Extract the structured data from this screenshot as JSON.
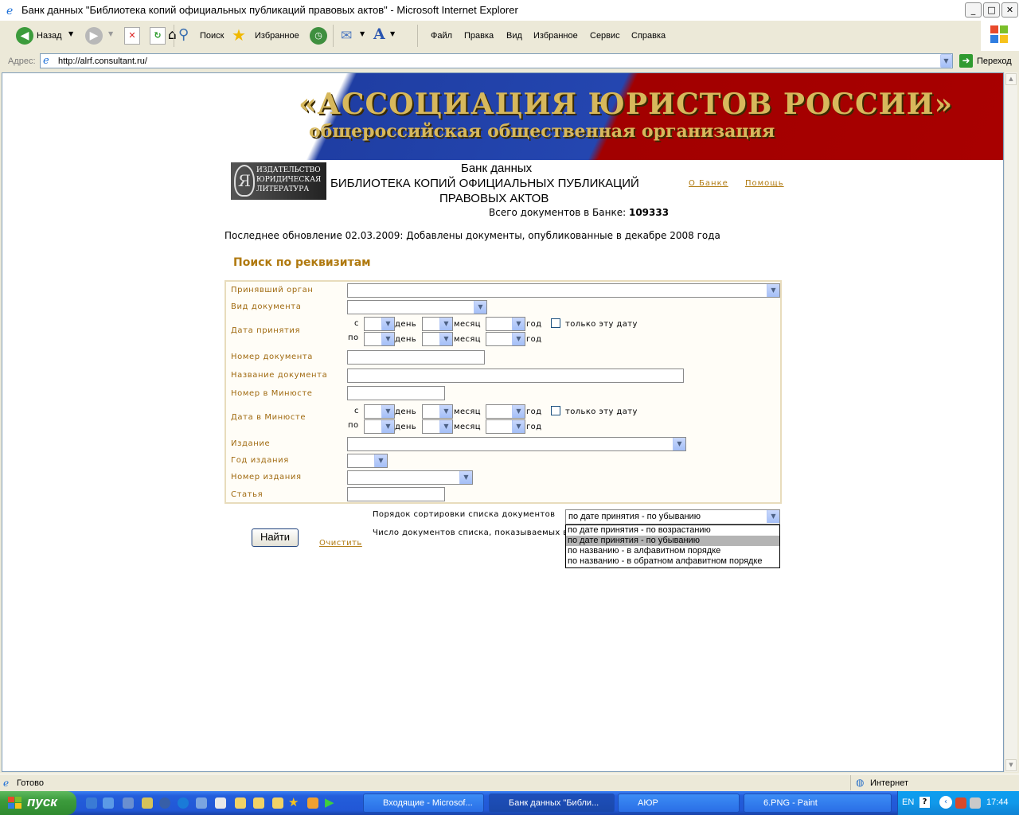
{
  "window": {
    "title": "Банк данных \"Библиотека копий официальных публикаций правовых актов\" - Microsoft Internet Explorer",
    "buttons": {
      "minimize": "_",
      "maximize": "□",
      "close": "✕"
    }
  },
  "toolbar": {
    "back_label": "Назад",
    "search_label": "Поиск",
    "favorites_label": "Избранное",
    "menu": [
      "Файл",
      "Правка",
      "Вид",
      "Избранное",
      "Сервис",
      "Справка"
    ]
  },
  "address": {
    "label": "Адрес:",
    "url": "http://alrf.consultant.ru/",
    "go_label": "Переход"
  },
  "banner": {
    "line1": "«АССОЦИАЦИЯ ЮРИСТОВ РОССИИ»",
    "line2": "общероссийская общественная организация"
  },
  "header": {
    "logo_text": [
      "ИЗДАТЕЛЬСТВО",
      "ЮРИДИЧЕСКАЯ",
      "ЛИТЕРАТУРА"
    ],
    "line1": "Банк данных",
    "line2": "БИБЛИОТЕКА КОПИЙ ОФИЦИАЛЬНЫХ ПУБЛИКАЦИЙ",
    "line3": "ПРАВОВЫХ АКТОВ",
    "count_label": "Всего документов в Банке:",
    "count_value": "109333",
    "about_link": "О Банке",
    "help_link": "Помощь"
  },
  "update_notice": "Последнее обновление 02.03.2009: Добавлены документы, опубликованные в декабре 2008 года",
  "search": {
    "title": "Поиск по реквизитам",
    "fields": {
      "organ": "Принявший орган",
      "doc_type": "Вид документа",
      "adopt_date": "Дата принятия",
      "doc_number": "Номер документа",
      "doc_name": "Название документа",
      "minjust_number": "Номер в Минюсте",
      "minjust_date": "Дата в Минюсте",
      "edition": "Издание",
      "edition_year": "Год издания",
      "edition_number": "Номер издания",
      "article": "Статья"
    },
    "date_words": {
      "from": "с",
      "to": "по",
      "day": "день",
      "month": "месяц",
      "year": "год",
      "only_this_date": "только эту дату"
    },
    "sort_label": "Порядок сортировки списка документов",
    "count_label": "Число документов списка, показываемых в",
    "sort_selected": "по дате принятия - по убыванию",
    "sort_options": [
      "по дате принятия - по возрастанию",
      "по дате принятия - по убыванию",
      "по названию - в алфавитном порядке",
      "по названию - в обратном алфавитном порядке"
    ],
    "find_button": "Найти",
    "clear_link": "Очистить"
  },
  "statusbar": {
    "status": "Готово",
    "zone": "Интернет"
  },
  "taskbar": {
    "start_label": "пуск",
    "tasks": [
      "Входящие - Microsof...",
      "Банк данных \"Библи...",
      "АЮР",
      "6.PNG - Paint"
    ],
    "lang": "EN",
    "clock": "17:44"
  },
  "colors": {
    "accent_gold": "#b07a10",
    "banner_blue": "#2446b0",
    "banner_red": "#a80000",
    "selection": "#b4b4b4"
  }
}
